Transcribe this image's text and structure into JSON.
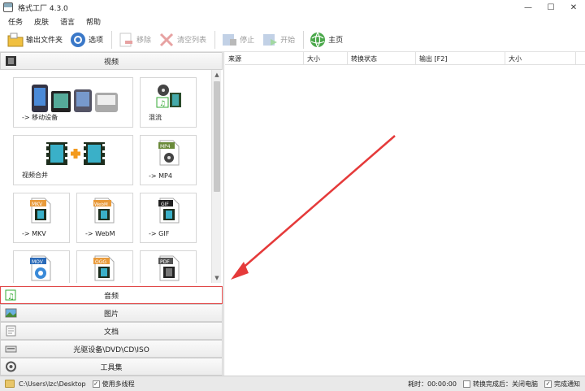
{
  "window": {
    "title": "格式工厂 4.3.0",
    "minimize": "—",
    "maximize": "☐",
    "close": "✕"
  },
  "menu": [
    "任务",
    "皮肤",
    "语言",
    "帮助"
  ],
  "toolbar": {
    "output_folder": "输出文件夹",
    "options": "选项",
    "remove": "移除",
    "clear_list": "清空列表",
    "stop": "停止",
    "start": "开始",
    "home": "主页"
  },
  "left": {
    "video_header": "视频",
    "tiles": [
      {
        "label": "-> 移动设备"
      },
      {
        "label": "混流"
      },
      {
        "label": "视频合并"
      },
      {
        "label": "-> MP4",
        "badge": "MP4"
      },
      {
        "label": "-> MKV",
        "badge": "MKV"
      },
      {
        "label": "-> WebM",
        "badge": "WebM"
      },
      {
        "label": "-> GIF",
        "badge": "GIF"
      },
      {
        "label": "",
        "badge": "MOV"
      },
      {
        "label": "",
        "badge": "OGG"
      },
      {
        "label": "",
        "badge": "PDF"
      }
    ],
    "categories": [
      "音频",
      "图片",
      "文档",
      "光驱设备\\DVD\\CD\\ISO",
      "工具集"
    ]
  },
  "list": {
    "columns": [
      "来源",
      "大小",
      "转换状态",
      "输出 [F2]",
      "大小"
    ]
  },
  "status": {
    "path": "C:\\Users\\lzc\\Desktop",
    "multithread": "使用多线程",
    "elapsed_label": "耗时：00:00:00",
    "after_convert": "转换完成后：关闭电脑",
    "notify": "完成通知",
    "check": "✓"
  },
  "colors": {
    "highlight": "#e04848",
    "arrow": "#e53a3a"
  }
}
